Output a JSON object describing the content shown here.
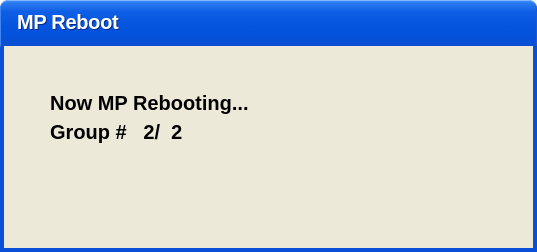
{
  "window": {
    "title": "MP Reboot"
  },
  "message": {
    "status_line": "Now MP Rebooting...",
    "group_line": "Group #   2/  2"
  },
  "colors": {
    "title_bar": "#0555df",
    "client_background": "#ece9d8",
    "title_text": "#ffffff",
    "message_text": "#000000"
  }
}
